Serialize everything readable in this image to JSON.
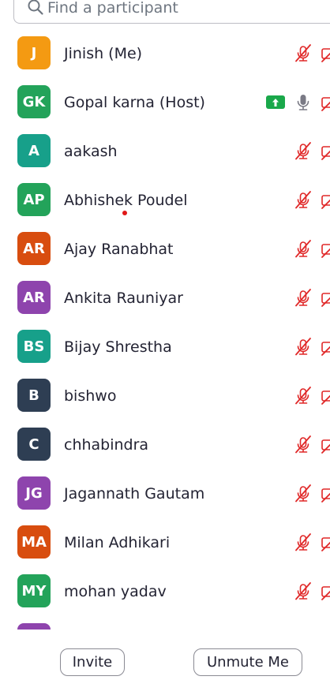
{
  "search": {
    "placeholder": "Find a participant"
  },
  "colors": {
    "muted_icon": "#e02828",
    "unmuted_icon": "#7a7a85",
    "share_badge": "#1aa84a",
    "annotation_dot": "#e01818"
  },
  "participants": [
    {
      "initials": "J",
      "name": "Jinish (Me)",
      "avatar_color": "#f49a12",
      "mic": "muted-mic-icon",
      "video": "video-off-icon"
    },
    {
      "initials": "GK",
      "name": "Gopal karna (Host)",
      "avatar_color": "#23a35a",
      "mic": "mic-icon",
      "video": "video-off-icon",
      "sharing": true
    },
    {
      "initials": "A",
      "name": "aakash",
      "avatar_color": "#17a08a",
      "mic": "muted-mic-icon",
      "video": "video-off-icon"
    },
    {
      "initials": "AP",
      "name": "Abhishek Poudel",
      "avatar_color": "#23a35a",
      "mic": "muted-mic-icon",
      "video": "video-off-icon"
    },
    {
      "initials": "AR",
      "name": "Ajay Ranabhat",
      "avatar_color": "#d84d0f",
      "mic": "muted-mic-icon",
      "video": "video-off-icon"
    },
    {
      "initials": "AR",
      "name": "Ankita Rauniyar",
      "avatar_color": "#8e44ad",
      "mic": "muted-mic-icon",
      "video": "video-off-icon"
    },
    {
      "initials": "BS",
      "name": "Bijay Shrestha",
      "avatar_color": "#17a08a",
      "mic": "muted-mic-icon",
      "video": "video-off-icon"
    },
    {
      "initials": "B",
      "name": "bishwo",
      "avatar_color": "#2e3e53",
      "mic": "muted-mic-icon",
      "video": "video-off-icon"
    },
    {
      "initials": "C",
      "name": "chhabindra",
      "avatar_color": "#2e3e53",
      "mic": "muted-mic-icon",
      "video": "video-off-icon"
    },
    {
      "initials": "JG",
      "name": "Jagannath Gautam",
      "avatar_color": "#8e44ad",
      "mic": "muted-mic-icon",
      "video": "video-off-icon"
    },
    {
      "initials": "MA",
      "name": "Milan Adhikari",
      "avatar_color": "#d84d0f",
      "mic": "muted-mic-icon",
      "video": "video-off-icon"
    },
    {
      "initials": "MY",
      "name": "mohan yadav",
      "avatar_color": "#23a35a",
      "mic": "muted-mic-icon",
      "video": "video-off-icon"
    },
    {
      "initials": "",
      "name": "",
      "avatar_color": "#8e44ad",
      "mic": "",
      "video": ""
    }
  ],
  "footer": {
    "invite_label": "Invite",
    "unmute_label": "Unmute Me"
  }
}
